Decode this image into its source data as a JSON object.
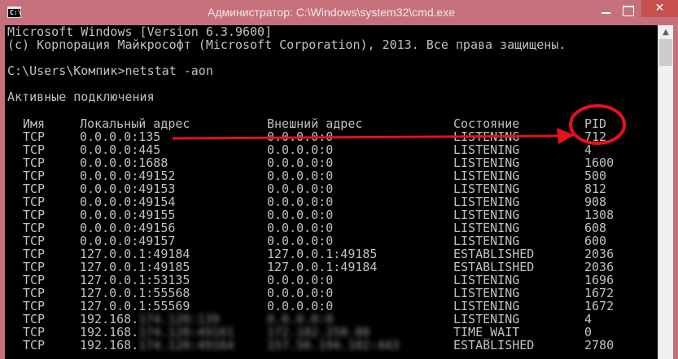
{
  "window": {
    "title": "Администратор: C:\\Windows\\system32\\cmd.exe",
    "icon": "cmd-icon",
    "icon_glyph": "C:\\",
    "close_glyph": "✕"
  },
  "console": {
    "lines": [
      "Microsoft Windows [Version 6.3.9600]",
      "(c) Корпорация Майкрософт (Microsoft Corporation), 2013. Все права защищены.",
      "",
      "C:\\Users\\Компик>netstat -aon",
      "",
      "Активные подключения",
      ""
    ],
    "table": {
      "headers": [
        "Имя",
        "Локальный адрес",
        "Внешний адрес",
        "Состояние",
        "PID"
      ],
      "rows": [
        {
          "proto": "TCP",
          "local": "0.0.0.0:135",
          "foreign": "0.0.0.0:0",
          "state": "LISTENING",
          "pid": "712"
        },
        {
          "proto": "TCP",
          "local": "0.0.0.0:445",
          "foreign": "0.0.0.0:0",
          "state": "LISTENING",
          "pid": "4"
        },
        {
          "proto": "TCP",
          "local": "0.0.0.0:1688",
          "foreign": "0.0.0.0:0",
          "state": "LISTENING",
          "pid": "1600"
        },
        {
          "proto": "TCP",
          "local": "0.0.0.0:49152",
          "foreign": "0.0.0.0:0",
          "state": "LISTENING",
          "pid": "500"
        },
        {
          "proto": "TCP",
          "local": "0.0.0.0:49153",
          "foreign": "0.0.0.0:0",
          "state": "LISTENING",
          "pid": "812"
        },
        {
          "proto": "TCP",
          "local": "0.0.0.0:49154",
          "foreign": "0.0.0.0:0",
          "state": "LISTENING",
          "pid": "908"
        },
        {
          "proto": "TCP",
          "local": "0.0.0.0:49155",
          "foreign": "0.0.0.0:0",
          "state": "LISTENING",
          "pid": "1308"
        },
        {
          "proto": "TCP",
          "local": "0.0.0.0:49156",
          "foreign": "0.0.0.0:0",
          "state": "LISTENING",
          "pid": "608"
        },
        {
          "proto": "TCP",
          "local": "0.0.0.0:49157",
          "foreign": "0.0.0.0:0",
          "state": "LISTENING",
          "pid": "600"
        },
        {
          "proto": "TCP",
          "local": "127.0.0.1:49184",
          "foreign": "127.0.0.1:49185",
          "state": "ESTABLISHED",
          "pid": "2036"
        },
        {
          "proto": "TCP",
          "local": "127.0.0.1:49185",
          "foreign": "127.0.0.1:49184",
          "state": "ESTABLISHED",
          "pid": "2036"
        },
        {
          "proto": "TCP",
          "local": "127.0.0.1:53135",
          "foreign": "0.0.0.0:0",
          "state": "LISTENING",
          "pid": "1696"
        },
        {
          "proto": "TCP",
          "local": "127.0.0.1:55568",
          "foreign": "0.0.0.0:0",
          "state": "LISTENING",
          "pid": "1672"
        },
        {
          "proto": "TCP",
          "local": "127.0.0.1:55569",
          "foreign": "0.0.0.0:0",
          "state": "LISTENING",
          "pid": "1672"
        },
        {
          "proto": "TCP",
          "local": "192.168.",
          "local_blur": "174.120:139",
          "foreign": "",
          "foreign_blur": "0.0.0.0:0",
          "state": "LISTENING",
          "pid": "4"
        },
        {
          "proto": "TCP",
          "local": "192.168.",
          "local_blur": "174.120:49161",
          "foreign": "",
          "foreign_blur": "172.182.250.80",
          "state": "TIME_WAIT",
          "pid": "0"
        },
        {
          "proto": "TCP",
          "local": "192.168.",
          "local_blur": "174.120:49164",
          "foreign": "",
          "foreign_blur": "157.56.194.102:443",
          "state": "ESTABLISHED",
          "pid": "2780"
        }
      ]
    }
  },
  "annotations": {
    "color": "#e8101c",
    "circled_header": "PID",
    "arrow_from_row": 0
  },
  "colors": {
    "titlebar": "#c6707c",
    "console_bg": "#000000",
    "console_fg": "#c0c0c0",
    "close_button": "#c7504f"
  }
}
